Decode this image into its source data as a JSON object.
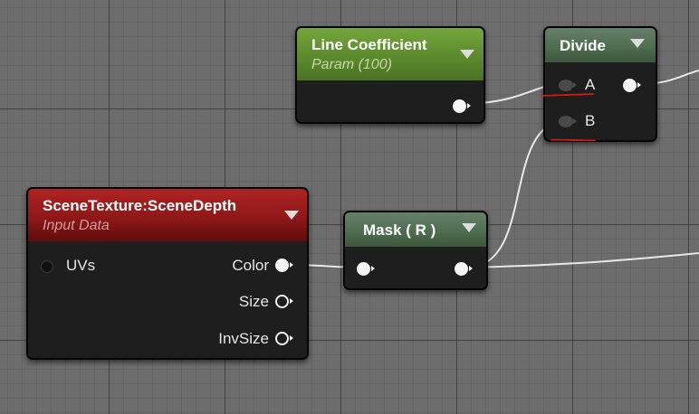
{
  "colors": {
    "param_header": "#5d8a2e",
    "texture_header": "#9a1a1a",
    "function_header": "#4d6b4d",
    "wire": "#e8e8e8",
    "annotation": "#d21a1a"
  },
  "nodes": {
    "line_coefficient": {
      "title": "Line Coefficient",
      "subtitle": "Param (100)",
      "icon": "chevron-down-icon"
    },
    "divide": {
      "title": "Divide",
      "icon": "chevron-down-icon",
      "inputs": [
        "A",
        "B"
      ]
    },
    "scene_texture": {
      "title": "SceneTexture:SceneDepth",
      "subtitle": "Input Data",
      "icon": "chevron-down-icon",
      "inputs": [
        "UVs"
      ],
      "outputs": [
        "Color",
        "Size",
        "InvSize"
      ]
    },
    "mask": {
      "title": "Mask ( R )",
      "icon": "chevron-down-icon"
    }
  }
}
